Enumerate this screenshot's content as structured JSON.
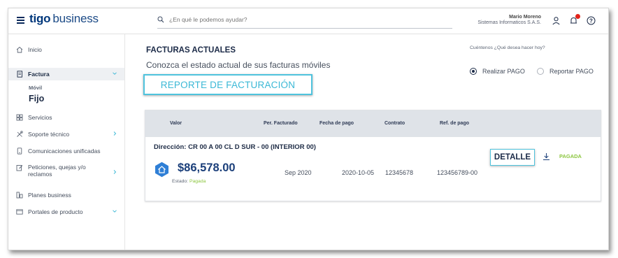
{
  "header": {
    "logo_tigo": "tigo",
    "logo_business": "business",
    "search_placeholder": "¿En qué le podemos ayudar?",
    "user_name": "Mario Moreno",
    "user_company": "Sistemas Informaticos S.A.S."
  },
  "sidebar": {
    "items": [
      {
        "label": "Inicio",
        "icon": "home-icon"
      },
      {
        "label": "Factura",
        "icon": "invoice-icon"
      },
      {
        "label": "Servicios",
        "icon": "grid-icon"
      },
      {
        "label": "Soporte técnico",
        "icon": "tools-icon"
      },
      {
        "label": "Comunicaciones unificadas",
        "icon": "phone-icon"
      },
      {
        "label": "Peticiones, quejas y/o reclamos",
        "icon": "complaint-icon"
      },
      {
        "label": "Planes business",
        "icon": "plans-icon"
      },
      {
        "label": "Portales de producto",
        "icon": "portal-icon"
      }
    ],
    "factura_sub1": "Móvil",
    "factura_sub2": "Fijo"
  },
  "main": {
    "title": "FACTURAS ACTUALES",
    "subtitle": "Conozca el estado actual de sus facturas móviles",
    "report_button": "REPORTE DE FACTURACIÓN",
    "pay_question": "Cuéntenos ¿Qué desea hacer hoy?",
    "radio_pay": "Realizar PAGO",
    "radio_report": "Reportar PAGO",
    "radio_selected": "Realizar PAGO"
  },
  "table": {
    "headers": [
      "Valor",
      "Per. Facturado",
      "Fecha de pago",
      "Contrato",
      "Ref. de pago"
    ],
    "address": "Dirección: CR 00 A 00 CL D SUR - 00 (INTERIOR 00)",
    "amount": "$86,578.00",
    "estado_label": "Estado:",
    "estado_value": "Pagada",
    "period": "Sep 2020",
    "fecha_pago": "2020-10-05",
    "contrato": "12345678",
    "ref_pago": "123456789-00",
    "detalle_button": "DETALLE",
    "status_badge": "PAGADA"
  },
  "colors": {
    "brand_navy": "#00377b",
    "accent_cyan": "#4fc3dd",
    "status_green": "#8cc63f",
    "header_gray": "#dfe3e8"
  }
}
